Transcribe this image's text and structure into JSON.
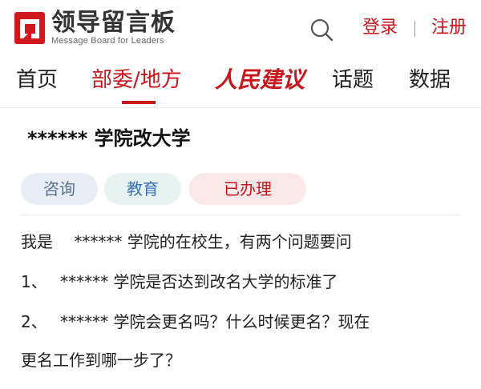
{
  "header": {
    "logo_title": "领导留言板",
    "logo_subtitle": "Message Board for Leaders",
    "login_label": "登录",
    "separator": "|",
    "register_label": "注册",
    "brand_color": "#c8161d"
  },
  "nav": {
    "items": [
      {
        "label": "首页"
      },
      {
        "label": "部委/地方"
      },
      {
        "label": "人民建议"
      },
      {
        "label": "话题"
      },
      {
        "label": "数据"
      }
    ],
    "active_index": 1
  },
  "message": {
    "title": "****** 学院改大学",
    "tags": [
      {
        "label": "咨询"
      },
      {
        "label": "教育"
      },
      {
        "label": "已办理"
      }
    ],
    "body_lines": [
      "我是　 ****** 学院的在校生，有两个问题要问",
      "1、　 ****** 学院是否达到改名大学的标准了",
      "2、　 ****** 学院会更名吗？什么时候更名？现在",
      "更名工作到哪一步了？"
    ]
  }
}
